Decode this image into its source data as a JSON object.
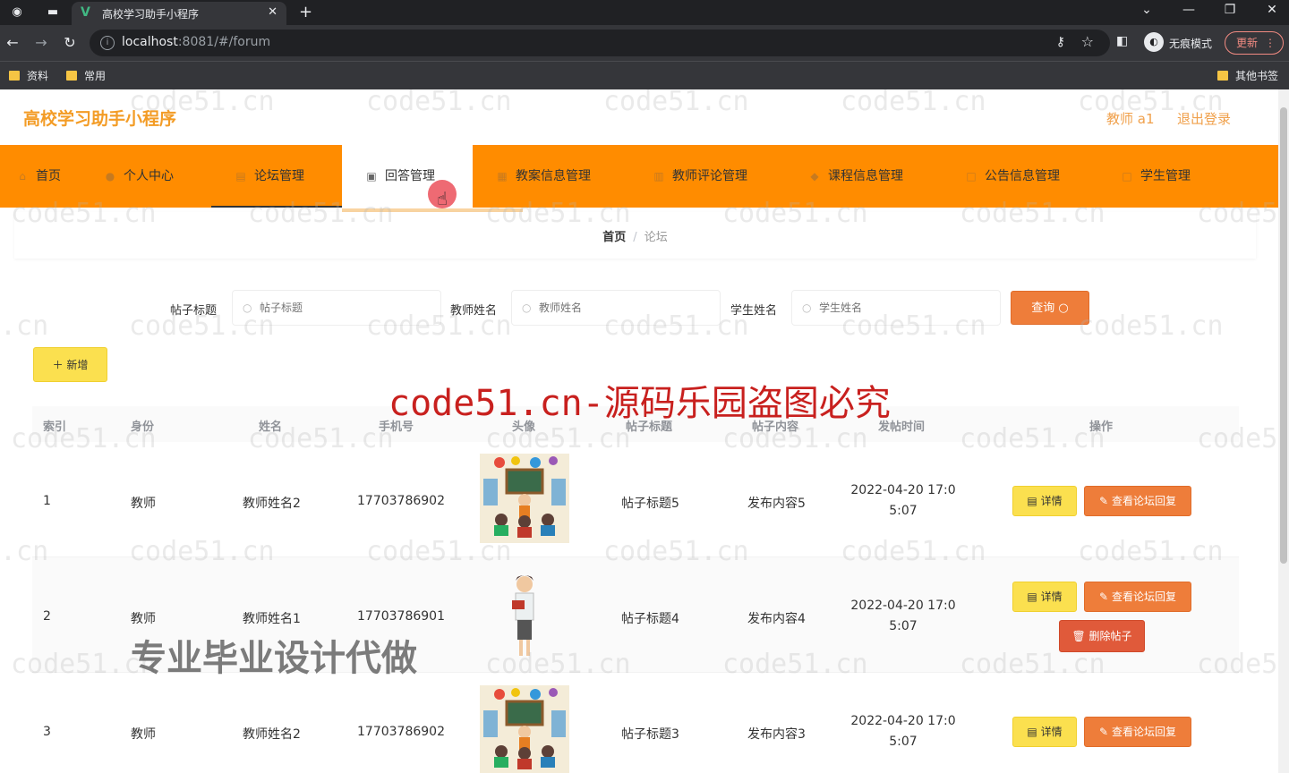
{
  "browser": {
    "tab_title": "高校学习助手小程序",
    "url_host": "localhost",
    "url_rest": ":8081/#/forum",
    "incognito_label": "无痕模式",
    "update_label": "更新",
    "bookmarks": [
      "资料",
      "常用"
    ],
    "other_bookmarks": "其他书签"
  },
  "header": {
    "title": "高校学习助手小程序",
    "user": "教师 a1",
    "logout": "退出登录"
  },
  "menu": [
    {
      "label": "首页",
      "icon": "home-icon"
    },
    {
      "label": "个人中心",
      "icon": "user-icon"
    },
    {
      "label": "论坛管理",
      "icon": "forum-icon"
    },
    {
      "label": "回答管理",
      "icon": "answer-icon"
    },
    {
      "label": "教案信息管理",
      "icon": "lesson-icon"
    },
    {
      "label": "教师评论管理",
      "icon": "comment-icon"
    },
    {
      "label": "课程信息管理",
      "icon": "course-icon"
    },
    {
      "label": "公告信息管理",
      "icon": "notice-icon"
    },
    {
      "label": "学生管理",
      "icon": "student-icon"
    }
  ],
  "breadcrumb": {
    "home": "首页",
    "separator": "/",
    "current": "论坛"
  },
  "search": {
    "post_title_label": "帖子标题",
    "post_title_placeholder": "帖子标题",
    "teacher_label": "教师姓名",
    "teacher_placeholder": "教师姓名",
    "student_label": "学生姓名",
    "student_placeholder": "学生姓名",
    "query_button": "查询"
  },
  "add_button": "新增",
  "table": {
    "columns": [
      "索引",
      "身份",
      "姓名",
      "手机号",
      "头像",
      "帖子标题",
      "帖子内容",
      "发帖时间",
      "操作"
    ],
    "rows": [
      {
        "index": "1",
        "role": "教师",
        "name": "教师姓名2",
        "phone": "17703786902",
        "title": "帖子标题5",
        "content": "发布内容5",
        "time_line1": "2022-04-20 17:0",
        "time_line2": "5:07",
        "detail": "详情",
        "reply": "查看论坛回复"
      },
      {
        "index": "2",
        "role": "教师",
        "name": "教师姓名1",
        "phone": "17703786901",
        "title": "帖子标题4",
        "content": "发布内容4",
        "time_line1": "2022-04-20 17:0",
        "time_line2": "5:07",
        "detail": "详情",
        "reply": "查看论坛回复",
        "delete": "删除帖子"
      },
      {
        "index": "3",
        "role": "教师",
        "name": "教师姓名2",
        "phone": "17703786902",
        "title": "帖子标题3",
        "content": "发布内容3",
        "time_line1": "2022-04-20 17:0",
        "time_line2": "5:07",
        "detail": "详情",
        "reply": "查看论坛回复"
      }
    ]
  },
  "watermarks": {
    "site": "code51.cn",
    "site_partial_end": "code5",
    "site_partial_start": ".cn",
    "banner": "code51.cn-源码乐园盗图必究",
    "promo": "专业毕业设计代做"
  },
  "colors": {
    "accent": "#ff8c00",
    "title": "#f39c26",
    "query": "#ee7d3a",
    "add": "#fbe04f"
  }
}
